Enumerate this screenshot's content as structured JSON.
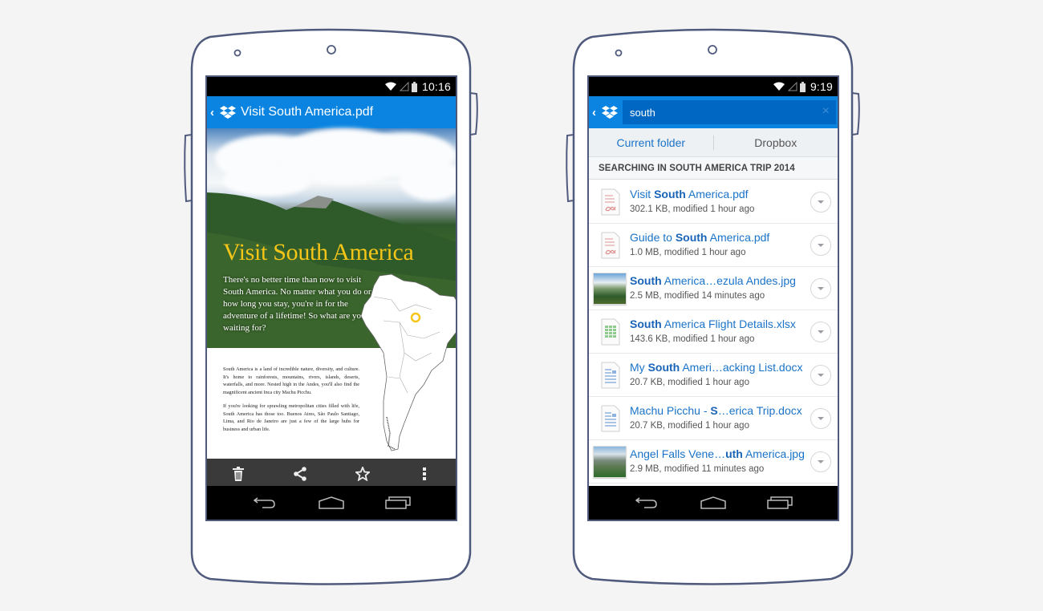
{
  "left_phone": {
    "status_bar": {
      "time": "10:16",
      "icons": [
        "wifi-icon",
        "signal-icon",
        "battery-icon"
      ]
    },
    "app_bar": {
      "back_glyph": "‹",
      "logo": "dropbox-logo-icon",
      "title": "Visit South America.pdf"
    },
    "document": {
      "title": "Visit South America",
      "intro": "There's no better time than now to visit South America. No matter what you do or how long you stay, you're in for the adventure of a lifetime! So what are you waiting for?",
      "paragraphs": [
        "South America is a land of incredible nature, diversity, and culture. It's home to rainforests, mountains, rivers, islands, deserts, waterfalls, and more. Nested high in the Andes, you'll also find the magnificent ancient Inca city Machu Picchu.",
        "If you're looking for sprawling metropolitan cities filled with life, South America has those too. Buenos Aires, São Paulo Santiago, Lima, and Rio de Janeiro are just a few of the large hubs for business and urban life."
      ],
      "accent_color": "#f5c518"
    },
    "action_bar": [
      {
        "name": "delete",
        "icon": "trash-icon"
      },
      {
        "name": "share",
        "icon": "share-icon"
      },
      {
        "name": "favorite",
        "icon": "star-icon"
      },
      {
        "name": "more",
        "icon": "overflow-menu-icon"
      }
    ]
  },
  "right_phone": {
    "status_bar": {
      "time": "9:19",
      "icons": [
        "wifi-icon",
        "signal-icon",
        "battery-icon"
      ]
    },
    "search": {
      "back_glyph": "‹",
      "logo": "dropbox-logo-icon",
      "query": "south",
      "clear_glyph": "×"
    },
    "scope_tabs": [
      {
        "label": "Current folder",
        "active": true
      },
      {
        "label": "Dropbox",
        "active": false
      }
    ],
    "search_header": "SEARCHING IN SOUTH AMERICA TRIP 2014",
    "results": [
      {
        "type": "pdf",
        "name_pre": "Visit ",
        "name_bold": "South",
        "name_post": " America.pdf",
        "meta": "302.1 KB, modified 1 hour ago"
      },
      {
        "type": "pdf",
        "name_pre": "Guide to ",
        "name_bold": "South",
        "name_post": " America.pdf",
        "meta": "1.0 MB, modified 1 hour ago"
      },
      {
        "type": "jpg",
        "name_pre": "",
        "name_bold": "South",
        "name_post": " America…ezula Andes.jpg",
        "meta": "2.5 MB, modified 14 minutes ago"
      },
      {
        "type": "xlsx",
        "name_pre": "",
        "name_bold": "South",
        "name_post": " America Flight Details.xlsx",
        "meta": "143.6 KB, modified 1 hour ago"
      },
      {
        "type": "docx",
        "name_pre": "My ",
        "name_bold": "South",
        "name_post": " Ameri…acking List.docx",
        "meta": "20.7 KB, modified 1 hour ago"
      },
      {
        "type": "docx",
        "name_pre": "Machu Picchu - ",
        "name_bold": "S",
        "name_post": "…erica Trip.docx",
        "meta": "20.7 KB, modified 1 hour ago"
      },
      {
        "type": "jpg2",
        "name_pre": "Angel Falls Vene…",
        "name_bold": "uth",
        "name_post": " America.jpg",
        "meta": "2.9 MB, modified 11 minutes ago"
      }
    ]
  },
  "colors": {
    "brand_blue": "#0a84e0",
    "search_field": "#0068c2",
    "link_blue": "#1a73c8",
    "frame_outline": "#4f5a7c"
  }
}
